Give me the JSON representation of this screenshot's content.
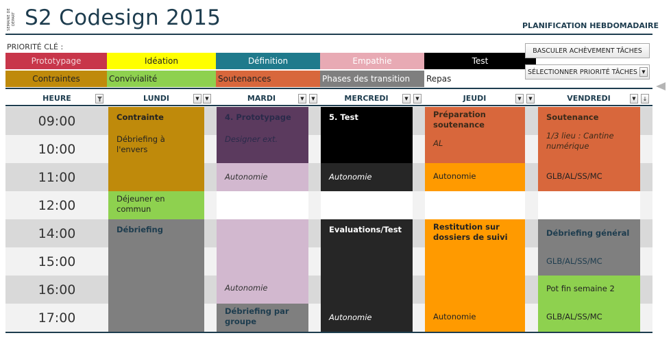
{
  "header": {
    "vertical_label": "SEMAINE DE DÉPART",
    "title": "S2 Codesign 2015",
    "subtitle": "PLANIFICATION HEBDOMADAIRE"
  },
  "priority": {
    "label": "PRIORITÉ CLÉ :",
    "row1": [
      {
        "label": "Prototypage",
        "color": "#c8364a",
        "text_color": "#f3d3d8"
      },
      {
        "label": "Idéation",
        "color": "#ffff00",
        "text_color": "#222222"
      },
      {
        "label": "Définition",
        "color": "#1f7a8c",
        "text_color": "#ffffff"
      },
      {
        "label": "Empathie",
        "color": "#e8aab4",
        "text_color": "#ffffff"
      },
      {
        "label": "Test",
        "color": "#000000",
        "text_color": "#ffffff"
      }
    ],
    "row2": [
      {
        "label": "Contraintes",
        "color": "#bf8a0b",
        "text_color": "#222222"
      },
      {
        "label": "Convivialité",
        "color": "#8ed14f",
        "text_color": "#222222"
      },
      {
        "label": "Soutenances",
        "color": "#d8673c",
        "text_color": "#222222"
      },
      {
        "label": "Phases des transition",
        "color": "#7f7f7f",
        "text_color": "#ffffff"
      },
      {
        "label": "Repas",
        "color": "#ffffff",
        "text_color": "#222222"
      }
    ]
  },
  "buttons": {
    "toggle_completion": "BASCULER ACHÈVEMENT TÂCHES",
    "select_priority": "SÉLECTIONNER PRIORITÉ TÂCHES"
  },
  "columns": {
    "heure": "HEURE",
    "days": [
      "LUNDI",
      "MARDI",
      "MERCREDI",
      "JEUDI",
      "VENDREDI"
    ]
  },
  "hours": [
    "09:00",
    "10:00",
    "11:00",
    "12:00",
    "14:00",
    "15:00",
    "16:00",
    "17:00"
  ],
  "schedule": {
    "lundi": [
      {
        "title": "Contrainte",
        "bold": true,
        "sub": "Débriefing à l'envers",
        "color": "#bf8a0b",
        "text_color": "#222222"
      },
      {
        "title": "Déjeuner en commun",
        "color": "#8ed14f",
        "text_color": "#222222"
      },
      {
        "title": "Débriefing",
        "bold": true,
        "color": "#7f7f7f",
        "text_color": "#1d3c4e"
      }
    ],
    "mardi": [
      {
        "title": "4. Prototypage",
        "bold": true,
        "sub": "Designer ext.",
        "color": "#5b3a5e",
        "text_color": "#2a2a4a"
      },
      {
        "title": "Autonomie",
        "italic": true,
        "color": "#d2b8cf",
        "text_color": "#333333"
      },
      {
        "title": "Autonomie",
        "italic": true,
        "color": "#d2b8cf",
        "text_color": "#333333"
      },
      {
        "title": "Débriefing par groupe",
        "bold": true,
        "color": "#7f7f7f",
        "text_color": "#1d3c4e"
      }
    ],
    "mercredi": [
      {
        "title": "5. Test",
        "bold": true,
        "color": "#000000",
        "text_color": "#ffffff"
      },
      {
        "title": "Autonomie",
        "italic": true,
        "color": "#262626",
        "text_color": "#ffffff"
      },
      {
        "title": "Evaluations/Test",
        "bold": true,
        "color": "#262626",
        "text_color": "#ffffff"
      },
      {
        "title": "Autonomie",
        "italic": true,
        "color": "#262626",
        "text_color": "#ffffff"
      }
    ],
    "jeudi": [
      {
        "title": "Préparation soutenance",
        "bold": true,
        "sub": "AL",
        "color": "#d8673c",
        "text_color": "#3a2a1a"
      },
      {
        "title": "Autonomie",
        "color": "#ff9a00",
        "text_color": "#222222"
      },
      {
        "title": "Restitution sur dossiers de suivi",
        "bold": true,
        "color": "#ff9a00",
        "text_color": "#222222"
      },
      {
        "title": "Autonomie",
        "color": "#ff9a00",
        "text_color": "#222222"
      }
    ],
    "vendredi": [
      {
        "title": "Soutenance",
        "bold": true,
        "sub": "1/3 lieu : Cantine numérique",
        "color": "#d8673c",
        "text_color": "#3a2a1a"
      },
      {
        "title": "GLB/AL/SS/MC",
        "color": "#d8673c",
        "text_color": "#222222"
      },
      {
        "title": "Débriefing  général",
        "bold": true,
        "color": "#7f7f7f",
        "text_color": "#1d3c4e"
      },
      {
        "title": "GLB/AL/SS/MC",
        "color": "#7f7f7f",
        "text_color": "#1d3c4e"
      },
      {
        "title": "Pot fin semaine 2",
        "color": "#8ed14f",
        "text_color": "#222222"
      },
      {
        "title": "GLB/AL/SS/MC",
        "color": "#8ed14f",
        "text_color": "#222222"
      }
    ]
  }
}
